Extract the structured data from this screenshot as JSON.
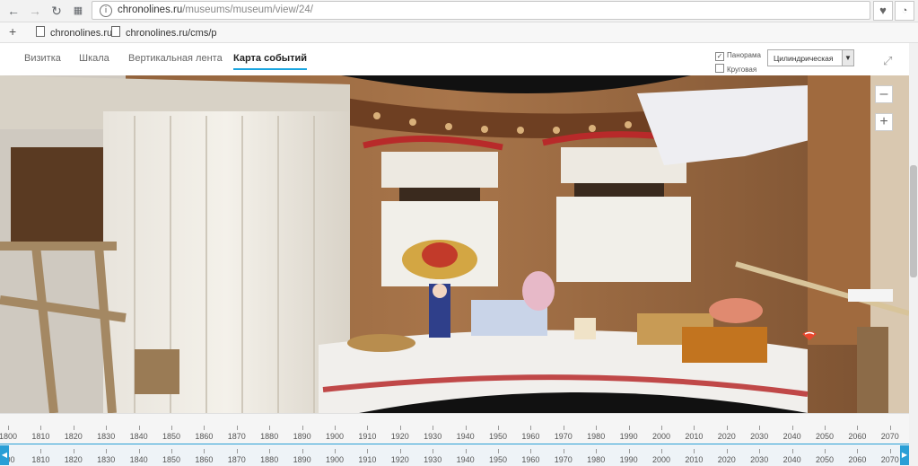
{
  "browser": {
    "url_host": "chronolines.ru",
    "url_path": "/museums/museum/view/24/",
    "bookmarks": [
      {
        "label": "chronolines.ru"
      },
      {
        "label": "chronolines.ru/cms/p"
      }
    ]
  },
  "tabs": [
    {
      "label": "Визитка"
    },
    {
      "label": "Шкала"
    },
    {
      "label": "Вертикальная лента"
    },
    {
      "label": "Карта событий"
    }
  ],
  "options": {
    "panorama_label": "Панорама",
    "circular_label": "Круговая",
    "projection_value": "Цилиндрическая"
  },
  "timeline": {
    "accent": "#2a9fd6",
    "years_top": [
      "1800",
      "1810",
      "1820",
      "1830",
      "1840",
      "1850",
      "1860",
      "1870",
      "1880",
      "1890",
      "1900",
      "1910",
      "1920",
      "1930",
      "1940",
      "1950",
      "1960",
      "1970",
      "1980",
      "1990",
      "2000",
      "2010",
      "2020",
      "2030",
      "2040",
      "2050",
      "2060",
      "2070"
    ],
    "years_bottom": [
      "800",
      "1810",
      "1820",
      "1830",
      "1840",
      "1850",
      "1860",
      "1870",
      "1880",
      "1890",
      "1900",
      "1910",
      "1920",
      "1930",
      "1940",
      "1950",
      "1960",
      "1970",
      "1980",
      "1990",
      "2000",
      "2010",
      "2020",
      "2030",
      "2040",
      "2050",
      "2060",
      "2070"
    ]
  }
}
